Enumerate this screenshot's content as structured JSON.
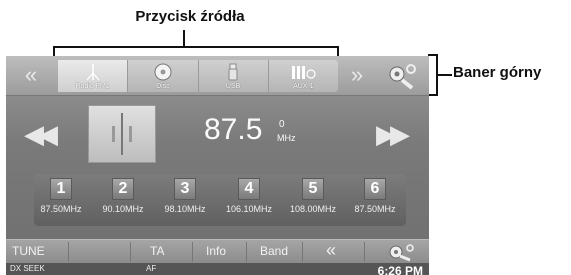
{
  "callouts": {
    "source_button": "Przycisk źródła",
    "top_banner": "Baner górny"
  },
  "banner": {
    "left_arrow": "«",
    "right_arrow": "»",
    "sources": [
      {
        "label": "Radio FM1",
        "icon": "antenna-icon",
        "active": true
      },
      {
        "label": "Disc",
        "icon": "disc-icon",
        "active": false
      },
      {
        "label": "USB",
        "icon": "usb-icon",
        "active": false
      },
      {
        "label": "AUX-1",
        "icon": "aux-icon",
        "active": false
      }
    ]
  },
  "tuner": {
    "frequency": "87.5",
    "decimal": "0",
    "unit": "MHz",
    "seek_back": "◀◀",
    "seek_forward": "▶▶"
  },
  "presets": [
    {
      "num": "1",
      "freq": "87.50MHz"
    },
    {
      "num": "2",
      "freq": "90.10MHz"
    },
    {
      "num": "3",
      "freq": "98.10MHz"
    },
    {
      "num": "4",
      "freq": "106.10MHz"
    },
    {
      "num": "5",
      "freq": "108.00MHz"
    },
    {
      "num": "6",
      "freq": "87.50MHz"
    }
  ],
  "bottom": {
    "tune": "TUNE",
    "ta": "TA",
    "info": "Info",
    "band": "Band",
    "back": "«"
  },
  "status": {
    "dx_seek": "DX SEEK",
    "af": "AF",
    "clock": "6:26 PM"
  }
}
